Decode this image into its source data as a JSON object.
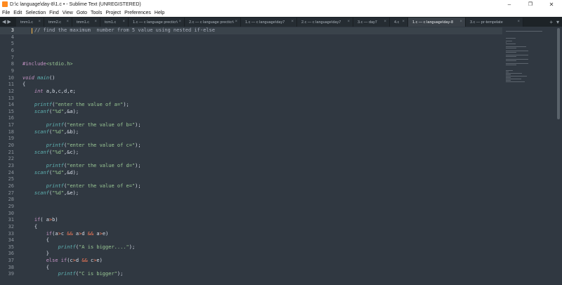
{
  "window": {
    "title": "D:\\c language\\day-8\\1.c • - Sublime Text (UNREGISTERED)",
    "minimize": "–",
    "maximize": "❐",
    "close": "✕"
  },
  "menu": [
    "File",
    "Edit",
    "Selection",
    "Find",
    "View",
    "Goto",
    "Tools",
    "Project",
    "Preferences",
    "Help"
  ],
  "tabs": [
    {
      "label": "tmm1.c",
      "active": false
    },
    {
      "label": "tmm2.c",
      "active": false
    },
    {
      "label": "tmm1.c",
      "active": false
    },
    {
      "label": "tcm1.c",
      "active": false
    },
    {
      "label": "1.c — c language precticr\\p-2",
      "active": false
    },
    {
      "label": "2.c — c language precticr\\p-2",
      "active": false
    },
    {
      "label": "1.c — c language\\day7",
      "active": false
    },
    {
      "label": "2.c — c language\\day7",
      "active": false
    },
    {
      "label": "3.c — day7",
      "active": false
    },
    {
      "label": "4.c",
      "active": false
    },
    {
      "label": "1.c — c language\\day-8",
      "active": true
    },
    {
      "label": "3.c — pr-tempelate",
      "active": false
    }
  ],
  "tab_close_glyph": "×",
  "tab_tools": {
    "new_tab": "+",
    "overflow": "▾"
  },
  "nav_arrows": {
    "left": "◀",
    "right": "▶"
  },
  "editor": {
    "current_line": 3,
    "lines": [
      {
        "n": 3,
        "segs": [
          {
            "t": "    "
          },
          {
            "t": "// find the maximum  number from 5 value using nested if-else",
            "c": "cm"
          }
        ]
      },
      {
        "n": 4,
        "segs": []
      },
      {
        "n": 5,
        "segs": []
      },
      {
        "n": 6,
        "segs": []
      },
      {
        "n": 7,
        "segs": []
      },
      {
        "n": 8,
        "segs": [
          {
            "t": "#include",
            "c": "pp"
          },
          {
            "t": "<stdio.h>",
            "c": "str"
          }
        ]
      },
      {
        "n": 9,
        "segs": []
      },
      {
        "n": 10,
        "segs": [
          {
            "t": "void",
            "c": "ty"
          },
          {
            "t": " "
          },
          {
            "t": "main",
            "c": "fn"
          },
          {
            "t": "()"
          }
        ]
      },
      {
        "n": 11,
        "segs": [
          {
            "t": "{"
          }
        ]
      },
      {
        "n": 12,
        "segs": [
          {
            "t": "    "
          },
          {
            "t": "int",
            "c": "ty"
          },
          {
            "t": " a,b,c,d,e;"
          }
        ]
      },
      {
        "n": 13,
        "segs": []
      },
      {
        "n": 14,
        "segs": [
          {
            "t": "    "
          },
          {
            "t": "printf",
            "c": "fn"
          },
          {
            "t": "("
          },
          {
            "t": "\"enter the value of a=\"",
            "c": "str"
          },
          {
            "t": ");"
          }
        ]
      },
      {
        "n": 15,
        "segs": [
          {
            "t": "    "
          },
          {
            "t": "scanf",
            "c": "fn"
          },
          {
            "t": "("
          },
          {
            "t": "\"%d\"",
            "c": "str"
          },
          {
            "t": ",&a);"
          }
        ]
      },
      {
        "n": 16,
        "segs": []
      },
      {
        "n": 17,
        "segs": [
          {
            "t": "        "
          },
          {
            "t": "printf",
            "c": "fn"
          },
          {
            "t": "("
          },
          {
            "t": "\"enter the value of b=\"",
            "c": "str"
          },
          {
            "t": ");"
          }
        ]
      },
      {
        "n": 18,
        "segs": [
          {
            "t": "    "
          },
          {
            "t": "scanf",
            "c": "fn"
          },
          {
            "t": "("
          },
          {
            "t": "\"%d\"",
            "c": "str"
          },
          {
            "t": ",&b);"
          }
        ]
      },
      {
        "n": 19,
        "segs": []
      },
      {
        "n": 20,
        "segs": [
          {
            "t": "        "
          },
          {
            "t": "printf",
            "c": "fn"
          },
          {
            "t": "("
          },
          {
            "t": "\"enter the value of c=\"",
            "c": "str"
          },
          {
            "t": ");"
          }
        ]
      },
      {
        "n": 21,
        "segs": [
          {
            "t": "    "
          },
          {
            "t": "scanf",
            "c": "fn"
          },
          {
            "t": "("
          },
          {
            "t": "\"%d\"",
            "c": "str"
          },
          {
            "t": ",&c);"
          }
        ]
      },
      {
        "n": 22,
        "segs": []
      },
      {
        "n": 23,
        "segs": [
          {
            "t": "        "
          },
          {
            "t": "printf",
            "c": "fn"
          },
          {
            "t": "("
          },
          {
            "t": "\"enter the value of d=\"",
            "c": "str"
          },
          {
            "t": ");"
          }
        ]
      },
      {
        "n": 24,
        "segs": [
          {
            "t": "    "
          },
          {
            "t": "scanf",
            "c": "fn"
          },
          {
            "t": "("
          },
          {
            "t": "\"%d\"",
            "c": "str"
          },
          {
            "t": ",&d);"
          }
        ]
      },
      {
        "n": 25,
        "segs": []
      },
      {
        "n": 26,
        "segs": [
          {
            "t": "        "
          },
          {
            "t": "printf",
            "c": "fn"
          },
          {
            "t": "("
          },
          {
            "t": "\"enter the value of e=\"",
            "c": "str"
          },
          {
            "t": ");"
          }
        ]
      },
      {
        "n": 27,
        "segs": [
          {
            "t": "    "
          },
          {
            "t": "scanf",
            "c": "fn"
          },
          {
            "t": "("
          },
          {
            "t": "\"%d\"",
            "c": "str"
          },
          {
            "t": ",&e);"
          }
        ]
      },
      {
        "n": 28,
        "segs": []
      },
      {
        "n": 29,
        "segs": []
      },
      {
        "n": 30,
        "segs": []
      },
      {
        "n": 31,
        "segs": [
          {
            "t": "    "
          },
          {
            "t": "if",
            "c": "kw"
          },
          {
            "t": "( a"
          },
          {
            "t": ">",
            "c": "op"
          },
          {
            "t": "b)"
          }
        ]
      },
      {
        "n": 32,
        "segs": [
          {
            "t": "    {"
          }
        ]
      },
      {
        "n": 33,
        "segs": [
          {
            "t": "        "
          },
          {
            "t": "if",
            "c": "kw"
          },
          {
            "t": "(a"
          },
          {
            "t": ">",
            "c": "op"
          },
          {
            "t": "c "
          },
          {
            "t": "&&",
            "c": "op"
          },
          {
            "t": " a"
          },
          {
            "t": ">",
            "c": "op"
          },
          {
            "t": "d "
          },
          {
            "t": "&&",
            "c": "op"
          },
          {
            "t": " a"
          },
          {
            "t": ">",
            "c": "op"
          },
          {
            "t": "e)"
          }
        ]
      },
      {
        "n": 34,
        "segs": [
          {
            "t": "        {"
          }
        ]
      },
      {
        "n": 35,
        "segs": [
          {
            "t": "            "
          },
          {
            "t": "printf",
            "c": "fn"
          },
          {
            "t": "("
          },
          {
            "t": "\"A is bigger....\"",
            "c": "str"
          },
          {
            "t": ");"
          }
        ]
      },
      {
        "n": 36,
        "segs": [
          {
            "t": "        }"
          }
        ]
      },
      {
        "n": 37,
        "segs": [
          {
            "t": "        "
          },
          {
            "t": "else",
            "c": "kw"
          },
          {
            "t": " "
          },
          {
            "t": "if",
            "c": "kw"
          },
          {
            "t": "(c"
          },
          {
            "t": ">",
            "c": "op"
          },
          {
            "t": "d "
          },
          {
            "t": "&&",
            "c": "op"
          },
          {
            "t": " c"
          },
          {
            "t": ">",
            "c": "op"
          },
          {
            "t": "e)"
          }
        ]
      },
      {
        "n": 38,
        "segs": [
          {
            "t": "        {"
          }
        ]
      },
      {
        "n": 39,
        "segs": [
          {
            "t": "            "
          },
          {
            "t": "printf",
            "c": "fn"
          },
          {
            "t": "("
          },
          {
            "t": "\"C is bigger\"",
            "c": "str"
          },
          {
            "t": ");"
          }
        ]
      }
    ]
  },
  "colors": {
    "background": "#303841",
    "tabbar": "#1d2327",
    "keyword": "#c594c5",
    "function": "#5fb3b3",
    "string": "#99c794",
    "operator": "#f97b58",
    "comment": "#a7adba",
    "cursor": "#f6b547"
  }
}
